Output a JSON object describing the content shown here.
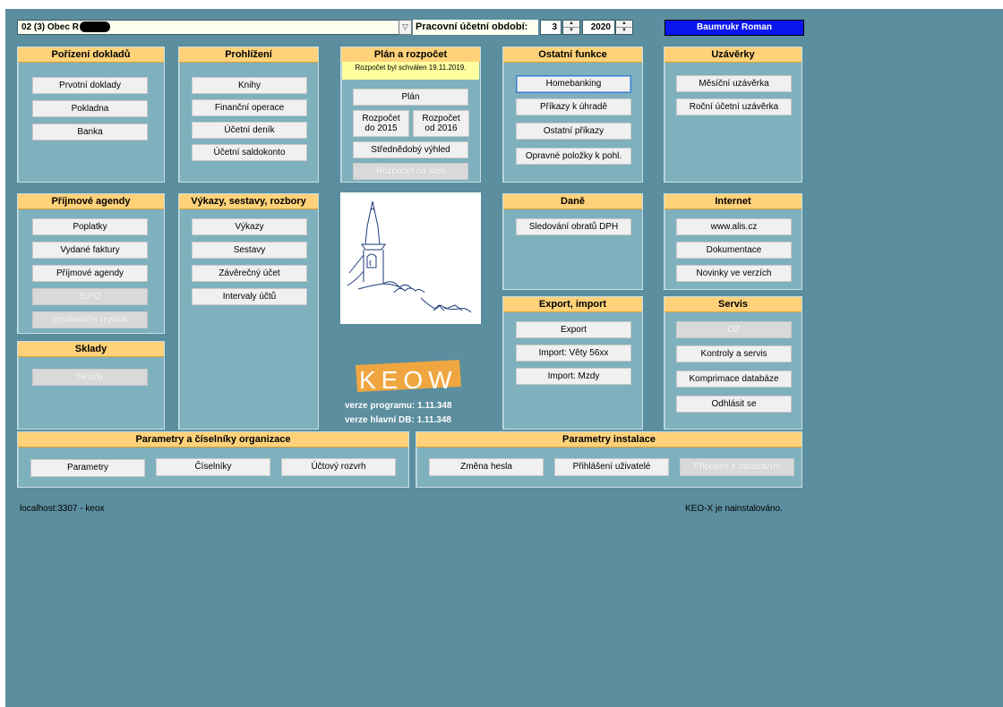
{
  "header": {
    "org": "02 (3) Obec R",
    "period_label": "Pracovní účetní období:",
    "month": "3",
    "year": "2020",
    "user": "Baumrukr Roman"
  },
  "panels": {
    "porizeni": {
      "title": "Pořízení dokladů",
      "buttons": [
        "Prvotní doklady",
        "Pokladna",
        "Banka"
      ]
    },
    "prohlizeni": {
      "title": "Prohlížení",
      "buttons": [
        "Knihy",
        "Finanční operace",
        "Účetní deník",
        "Účetní saldokonto"
      ]
    },
    "plan": {
      "title": "Plán a rozpočet",
      "note": "Rozpočet byl schválen 19.11.2019.",
      "plan_btn": "Plán",
      "rozpocet_do_a": "Rozpočet",
      "rozpocet_do_b": "do 2015",
      "rozpocet_od_a": "Rozpočet",
      "rozpocet_od_b": "od 2016",
      "strednedoby": "Střednědobý výhled",
      "web": "Rozpočet na web"
    },
    "ostatni": {
      "title": "Ostatní funkce",
      "buttons": [
        "Homebanking",
        "Příkazy k úhradě",
        "Ostatní příkazy",
        "Opravné položky k pohl."
      ]
    },
    "uzaverky": {
      "title": "Uzávěrky",
      "buttons": [
        "Měsíční uzávěrka",
        "Roční účetní uzávěrka"
      ]
    },
    "prijmove": {
      "title": "Příjmové agendy",
      "buttons": [
        "Poplatky",
        "Vydané faktury",
        "Příjmové agendy",
        "SIPO",
        "Insolvenční rejstřík"
      ]
    },
    "vykazy": {
      "title": "Výkazy, sestavy, rozbory",
      "buttons": [
        "Výkazy",
        "Sestavy",
        "Závěrečný účet",
        "Intervaly účtů"
      ]
    },
    "dane": {
      "title": "Daně",
      "buttons": [
        "Sledování obratů DPH"
      ]
    },
    "internet": {
      "title": "Internet",
      "buttons": [
        "www.alis.cz",
        "Dokumentace",
        "Novinky ve verzích"
      ]
    },
    "sklady": {
      "title": "Sklady",
      "buttons": [
        "Sklady"
      ]
    },
    "export": {
      "title": "Export, import",
      "buttons": [
        "Export",
        "Import: Věty 56xx",
        "Import: Mzdy"
      ]
    },
    "servis": {
      "title": "Servis",
      "buttons": [
        "OZ",
        "Kontroly a servis",
        "Komprimace databáze",
        "Odhlásit se"
      ]
    },
    "parametry_org": {
      "title": "Parametry a číselníky organizace",
      "buttons": [
        "Parametry",
        "Číselníky",
        "Účtový rozvrh"
      ]
    },
    "parametry_inst": {
      "title": "Parametry instalace",
      "buttons": [
        "Změna hesla",
        "Přihlášení uživatelé",
        "Připojení k databázím"
      ]
    }
  },
  "logo": {
    "keow_text": "KEOW"
  },
  "version": {
    "program": "verze programu: 1.11.348",
    "db": "verze hlavní DB: 1.11.348"
  },
  "status": {
    "left": "localhost:3307 - keox",
    "right": "KEO-X je nainstalováno."
  },
  "colors": {
    "background": "#5b8e9e",
    "panel": "#7fb0bd",
    "title_bar": "#ffd27a",
    "user_box": "#0a16f0",
    "note": "#ffff9e"
  }
}
